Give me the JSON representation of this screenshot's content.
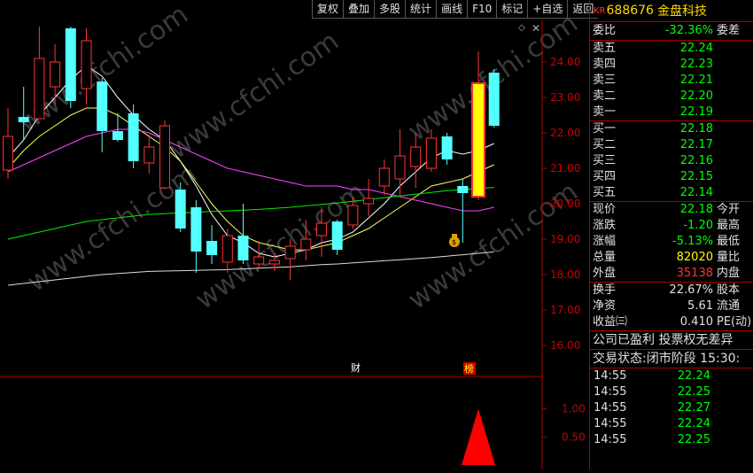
{
  "toolbar": {
    "buttons": [
      "复权",
      "叠加",
      "多股",
      "统计",
      "画线",
      "F10",
      "标记",
      "+自选",
      "返回"
    ]
  },
  "icons": {
    "diamond": "diamond-icon",
    "cross": "close-icon"
  },
  "chart": {
    "watermark": "www.cfchi.com",
    "event_labels": [
      "财",
      "榜"
    ],
    "money_bag": "money-bag-icon"
  },
  "chart_data": [
    {
      "type": "candlestick",
      "ylim": [
        15.5,
        25.0
      ],
      "y_ticks": [
        "24.00",
        "23.00",
        "22.00",
        "21.00",
        "20.00",
        "19.00",
        "18.00",
        "17.00",
        "16.00"
      ],
      "y_values": [
        24,
        23,
        22,
        21,
        20,
        19,
        18,
        17,
        16
      ],
      "up_color": "#ff3333",
      "down_color": "#54ffff",
      "limit_color": "#ffff00",
      "candles": [
        {
          "o": 20.95,
          "c": 21.9,
          "h": 22.7,
          "l": 20.7
        },
        {
          "o": 22.45,
          "c": 22.3,
          "h": 23.3,
          "l": 21.8
        },
        {
          "o": 22.4,
          "c": 24.1,
          "h": 25.0,
          "l": 22.4
        },
        {
          "o": 23.3,
          "c": 24.0,
          "h": 24.5,
          "l": 22.8
        },
        {
          "o": 24.95,
          "c": 22.9,
          "h": 25.0,
          "l": 22.7
        },
        {
          "o": 23.25,
          "c": 24.6,
          "h": 24.95,
          "l": 22.8
        },
        {
          "o": 23.45,
          "c": 22.05,
          "h": 23.55,
          "l": 21.45
        },
        {
          "o": 22.05,
          "c": 21.8,
          "h": 22.55,
          "l": 21.75
        },
        {
          "o": 22.55,
          "c": 21.2,
          "h": 22.8,
          "l": 21.0
        },
        {
          "o": 21.15,
          "c": 21.6,
          "h": 21.95,
          "l": 20.85
        },
        {
          "o": 20.45,
          "c": 22.2,
          "h": 22.35,
          "l": 20.4
        },
        {
          "o": 20.4,
          "c": 19.3,
          "h": 20.6,
          "l": 19.2
        },
        {
          "o": 19.9,
          "c": 18.65,
          "h": 20.1,
          "l": 18.05
        },
        {
          "o": 18.95,
          "c": 18.55,
          "h": 19.4,
          "l": 18.3
        },
        {
          "o": 18.35,
          "c": 19.1,
          "h": 19.3,
          "l": 18.05
        },
        {
          "o": 19.1,
          "c": 18.4,
          "h": 20.0,
          "l": 18.3
        },
        {
          "o": 18.3,
          "c": 18.5,
          "h": 18.95,
          "l": 18.2
        },
        {
          "o": 18.3,
          "c": 18.4,
          "h": 18.6,
          "l": 18.1
        },
        {
          "o": 18.45,
          "c": 18.8,
          "h": 19.0,
          "l": 17.85
        },
        {
          "o": 18.7,
          "c": 19.0,
          "h": 19.55,
          "l": 18.4
        },
        {
          "o": 19.1,
          "c": 19.45,
          "h": 19.9,
          "l": 18.5
        },
        {
          "o": 19.5,
          "c": 18.7,
          "h": 19.55,
          "l": 18.55
        },
        {
          "o": 19.4,
          "c": 19.95,
          "h": 20.2,
          "l": 19.3
        },
        {
          "o": 20.0,
          "c": 20.15,
          "h": 20.7,
          "l": 19.65
        },
        {
          "o": 20.5,
          "c": 21.0,
          "h": 21.25,
          "l": 20.25
        },
        {
          "o": 20.7,
          "c": 21.35,
          "h": 22.1,
          "l": 20.2
        },
        {
          "o": 21.05,
          "c": 21.6,
          "h": 22.0,
          "l": 20.45
        },
        {
          "o": 21.0,
          "c": 21.85,
          "h": 22.1,
          "l": 20.9
        },
        {
          "o": 21.9,
          "c": 21.25,
          "h": 22.0,
          "l": 21.1
        },
        {
          "o": 20.5,
          "c": 20.3,
          "h": 20.7,
          "l": 18.9
        },
        {
          "o": 20.2,
          "c": 23.4,
          "h": 24.3,
          "l": 20.1,
          "limit": true
        },
        {
          "o": 23.7,
          "c": 22.2,
          "h": 23.8,
          "l": 22.15
        }
      ],
      "ma_lines": [
        {
          "color": "#ffffff",
          "values": [
            21.3,
            21.8,
            22.5,
            23.0,
            23.5,
            23.9,
            23.6,
            23.0,
            22.5,
            22.1,
            21.8,
            21.2,
            20.5,
            19.7,
            19.1,
            18.9,
            18.6,
            18.5,
            18.6,
            18.7,
            18.9,
            19.0,
            19.2,
            19.6,
            20.0,
            20.5,
            20.9,
            21.3,
            21.5,
            21.4,
            21.5,
            21.7
          ]
        },
        {
          "color": "#ffff55",
          "values": [
            21.0,
            21.5,
            21.9,
            22.2,
            22.5,
            22.7,
            22.7,
            22.5,
            22.2,
            21.9,
            21.6,
            21.2,
            20.6,
            20.0,
            19.5,
            19.1,
            18.9,
            18.8,
            18.7,
            18.7,
            18.8,
            18.9,
            19.1,
            19.3,
            19.6,
            19.9,
            20.2,
            20.5,
            20.6,
            20.7,
            20.9,
            21.1
          ]
        },
        {
          "color": "#ff44ff",
          "values": [
            20.9,
            21.1,
            21.3,
            21.5,
            21.7,
            21.9,
            22.0,
            22.1,
            22.1,
            22.0,
            21.8,
            21.6,
            21.4,
            21.2,
            21.0,
            20.9,
            20.8,
            20.7,
            20.6,
            20.5,
            20.5,
            20.5,
            20.4,
            20.4,
            20.3,
            20.2,
            20.1,
            20.0,
            19.9,
            19.8,
            19.8,
            19.9
          ]
        },
        {
          "color": "#00ee00",
          "values": [
            19.0,
            19.1,
            19.2,
            19.3,
            19.4,
            19.5,
            19.55,
            19.6,
            19.65,
            19.7,
            19.72,
            19.74,
            19.76,
            19.78,
            19.8,
            19.82,
            19.84,
            19.87,
            19.9,
            19.94,
            19.98,
            20.02,
            20.07,
            20.12,
            20.17,
            20.22,
            20.27,
            20.32,
            20.37,
            20.4,
            20.43,
            20.46
          ]
        },
        {
          "color": "#dddddd",
          "values": [
            17.7,
            17.75,
            17.8,
            17.85,
            17.9,
            17.95,
            18.0,
            18.03,
            18.06,
            18.09,
            18.1,
            18.11,
            18.12,
            18.13,
            18.14,
            18.16,
            18.18,
            18.2,
            18.22,
            18.25,
            18.28,
            18.3,
            18.33,
            18.36,
            18.39,
            18.42,
            18.45,
            18.48,
            18.52,
            18.56,
            18.6,
            18.64
          ]
        }
      ]
    },
    {
      "type": "bar",
      "ylim": [
        0,
        1.5
      ],
      "y_ticks": [
        "1.00",
        "0.50"
      ],
      "y_values": [
        1.0,
        0.5
      ],
      "spike_index": 30,
      "spike_value": 1.0,
      "spike_color": "#ff0000"
    }
  ],
  "quote": {
    "exchange": "KR",
    "code": "688676",
    "name": "金盘科技",
    "weibi_label": "委比",
    "weibi_value": "-32.36%",
    "weicha_label": "委差",
    "asks": [
      {
        "label": "卖五",
        "price": "22.24"
      },
      {
        "label": "卖四",
        "price": "22.23"
      },
      {
        "label": "卖三",
        "price": "22.21"
      },
      {
        "label": "卖二",
        "price": "22.20"
      },
      {
        "label": "卖一",
        "price": "22.19"
      }
    ],
    "bids": [
      {
        "label": "买一",
        "price": "22.18"
      },
      {
        "label": "买二",
        "price": "22.17"
      },
      {
        "label": "买三",
        "price": "22.16"
      },
      {
        "label": "买四",
        "price": "22.15"
      },
      {
        "label": "买五",
        "price": "22.14"
      }
    ],
    "stats": [
      {
        "label": "现价",
        "value": "22.18",
        "label2": "今开",
        "cls": "green"
      },
      {
        "label": "涨跌",
        "value": "-1.20",
        "label2": "最高",
        "cls": "green"
      },
      {
        "label": "涨幅",
        "value": "-5.13%",
        "label2": "最低",
        "cls": "green"
      },
      {
        "label": "总量",
        "value": "82020",
        "label2": "量比",
        "cls": "yellow"
      },
      {
        "label": "外盘",
        "value": "35138",
        "label2": "内盘",
        "cls": "red"
      }
    ],
    "fundamentals": [
      {
        "label": "换手",
        "value": "22.67%",
        "label2": "股本"
      },
      {
        "label": "净资",
        "value": "5.61",
        "label2": "流通"
      },
      {
        "label": "收益㈢",
        "value": "0.410",
        "label2": "PE(动)"
      }
    ],
    "info_line1": "公司已盈利 投票权无差异",
    "info_line2": "交易状态:闭市阶段 15:30:",
    "ticks": [
      {
        "time": "14:55",
        "price": "22.24"
      },
      {
        "time": "14:55",
        "price": "22.25"
      },
      {
        "time": "14:55",
        "price": "22.27"
      },
      {
        "time": "14:55",
        "price": "22.24"
      },
      {
        "time": "14:55",
        "price": "22.25"
      }
    ]
  }
}
